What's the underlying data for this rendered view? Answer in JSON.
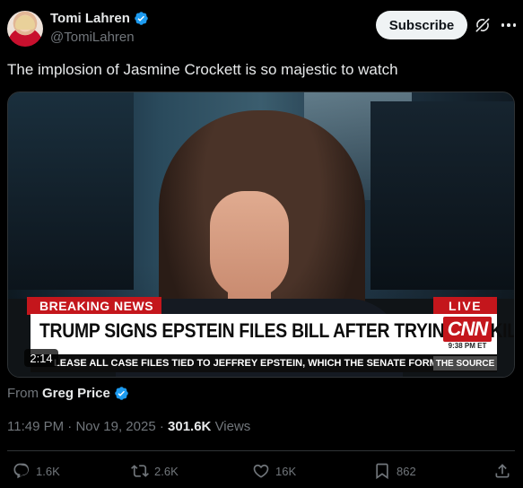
{
  "author": {
    "name": "Tomi Lahren",
    "handle": "@TomiLahren",
    "verified": true
  },
  "header": {
    "subscribe_label": "Subscribe"
  },
  "tweet": {
    "text": "The implosion of Jasmine Crockett is so majestic to watch"
  },
  "video": {
    "duration": "2:14",
    "breaking_label": "BREAKING NEWS",
    "live_label": "LIVE",
    "headline": "TRUMP SIGNS EPSTEIN FILES BILL AFTER TRYING TO KILL IT",
    "network": "CNN",
    "network_time": "9:38 PM ET",
    "ticker": "LEASE ALL CASE FILES TIED TO JEFFREY EPSTEIN, WHICH THE SENATE FORMALLY SE",
    "source_label": "THE SOURCE"
  },
  "from": {
    "label": "From",
    "name": "Greg Price"
  },
  "meta": {
    "time": "11:49 PM",
    "date": "Nov 19, 2025",
    "views_count": "301.6K",
    "views_label": "Views"
  },
  "actions": {
    "replies": "1.6K",
    "reposts": "2.6K",
    "likes": "16K",
    "bookmarks": "862"
  },
  "colors": {
    "background": "#000000",
    "text": "#e7e9ea",
    "muted": "#71767b",
    "verified": "#1d9bf0",
    "cnn_red": "#c4161c"
  }
}
